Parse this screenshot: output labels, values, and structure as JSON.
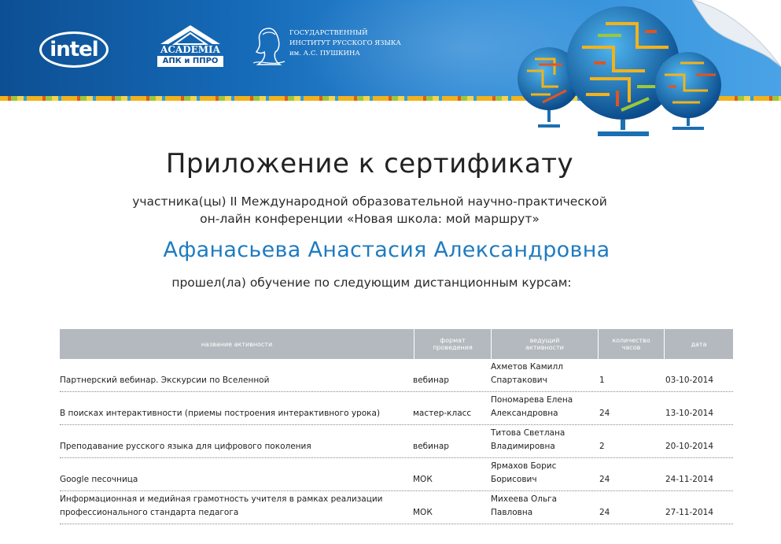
{
  "header": {
    "logo_intel": "intel",
    "logo_academia_word": "ACADEMIA",
    "logo_academia_sub": "АПК и ППРО",
    "logo_pushkin_lines": [
      "ГОСУДАРСТВЕННЫЙ",
      "ИНСТИТУТ РУССКОГО ЯЗЫКА",
      "им. А.С. ПУШКИНА"
    ]
  },
  "document": {
    "title": "Приложение к сертификату",
    "subtitle_lines": [
      "участника(цы) II Международной образовательной научно-практической",
      "он-лайн конференции «Новая школа: мой маршрут»"
    ],
    "participant_name": "Афанасьева Анастасия Александровна",
    "passed_text": "прошел(ла) обучение по следующим дистанционным курсам:"
  },
  "table": {
    "headers": [
      [
        "название активности"
      ],
      [
        "формат",
        "проведения"
      ],
      [
        "ведущий",
        "активности"
      ],
      [
        "количество",
        "часов"
      ],
      [
        "дата"
      ]
    ],
    "rows": [
      {
        "activity": [
          "Партнерский вебинар. Экскурсии по Вселенной"
        ],
        "format": "вебинар",
        "host": [
          "Ахметов Камилл",
          "Спартакович"
        ],
        "hours": "1",
        "date": "03-10-2014"
      },
      {
        "activity": [
          "В поисках интерактивности (приемы построения интерактивного урока)"
        ],
        "format": "мастер-класс",
        "host": [
          "Пономарева Елена",
          "Александровна"
        ],
        "hours": "24",
        "date": "13-10-2014"
      },
      {
        "activity": [
          "Преподавание русского языка для цифрового поколения"
        ],
        "format": "вебинар",
        "host": [
          "Титова Светлана",
          "Владимировна"
        ],
        "hours": "2",
        "date": "20-10-2014"
      },
      {
        "activity": [
          "Google песочница"
        ],
        "format": "МОК",
        "host": [
          "Ярмахов Борис",
          "Борисович"
        ],
        "hours": "24",
        "date": "24-11-2014"
      },
      {
        "activity": [
          "Информационная и медийная грамотность учителя в рамках реализации",
          "профессионального стандарта педагога"
        ],
        "format": "МОК",
        "host": [
          "Михеева Ольга",
          "Павловна"
        ],
        "hours": "24",
        "date": "27-11-2014"
      }
    ]
  },
  "colors": {
    "banner_dark": "#0d4f93",
    "banner_light": "#4aa3e6",
    "name_blue": "#1f7bc0",
    "table_header_gray": "#b3b9be"
  }
}
